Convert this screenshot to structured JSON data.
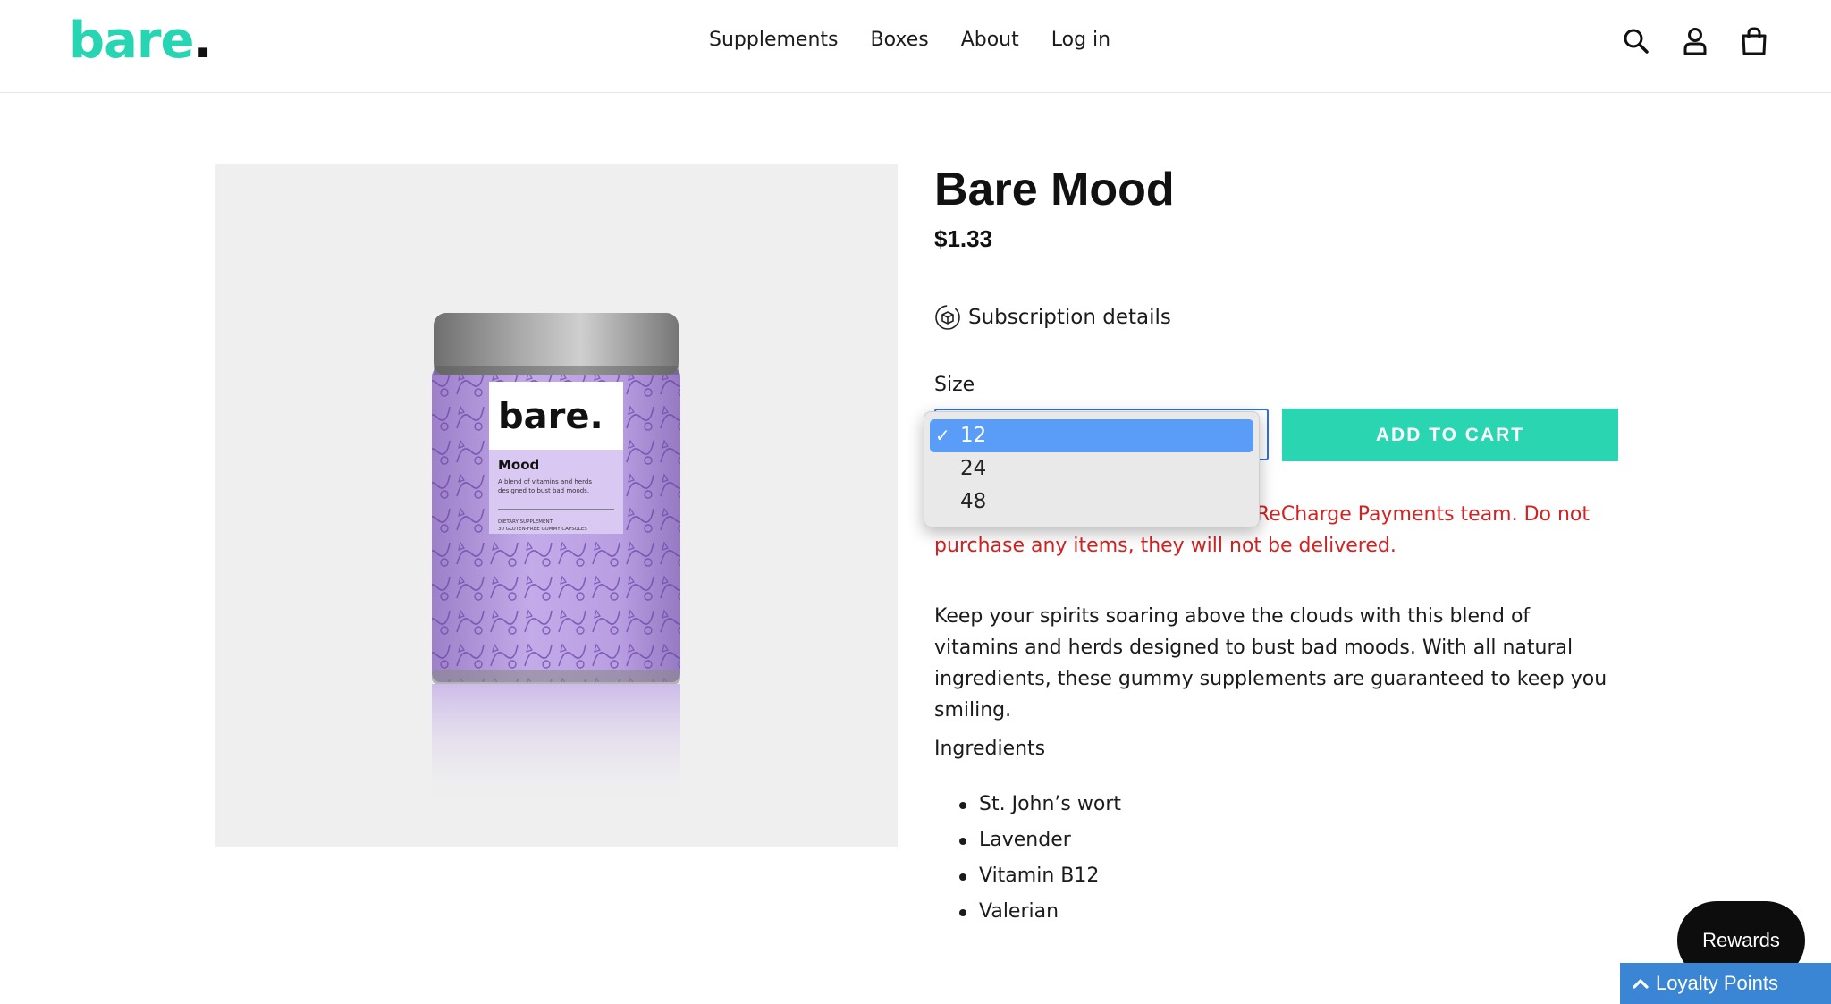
{
  "header": {
    "logo_text": "bare",
    "logo_dot": ".",
    "nav": [
      "Supplements",
      "Boxes",
      "About",
      "Log in"
    ],
    "icons": [
      "search-icon",
      "account-icon",
      "cart-icon"
    ]
  },
  "product": {
    "title": "Bare Mood",
    "price": "$1.33",
    "subscription_label": "Subscription details",
    "size_label": "Size",
    "size_options": [
      "12",
      "24",
      "48"
    ],
    "selected_size": "12",
    "check_mark": "✓",
    "add_to_cart": "ADD TO CART",
    "warning_visible": "ReCharge Payments team. Do not purchase any items, they will not be delivered.",
    "description": "Keep your spirits soaring above the clouds with this blend of vitamins and herds designed to bust bad moods. With all natural ingredients, these gummy supplements are guaranteed to keep you smiling.",
    "ingredients_label": "Ingredients",
    "ingredients": [
      "St. John’s wort",
      "Lavender",
      "Vitamin B12",
      "Valerian"
    ]
  },
  "tin_label": {
    "brand": "bare.",
    "name": "Mood",
    "tagline_1": "A blend of vitamins and herds",
    "tagline_2": "designed to bust bad moods.",
    "small_1": "DIETARY SUPPLEMENT",
    "small_2": "30 GLUTEN-FREE GUMMY CAPSULES"
  },
  "widgets": {
    "rewards": "Rewards",
    "loyalty": "Loyalty Points",
    "loyalty_chevron": "⌃"
  },
  "colors": {
    "brand": "#28d5b3",
    "cta": "#2ad5b2",
    "warning": "#d32222",
    "tin_purple": "#b79be0",
    "select_highlight": "#5a9df8",
    "loyalty": "#3a86d4"
  }
}
